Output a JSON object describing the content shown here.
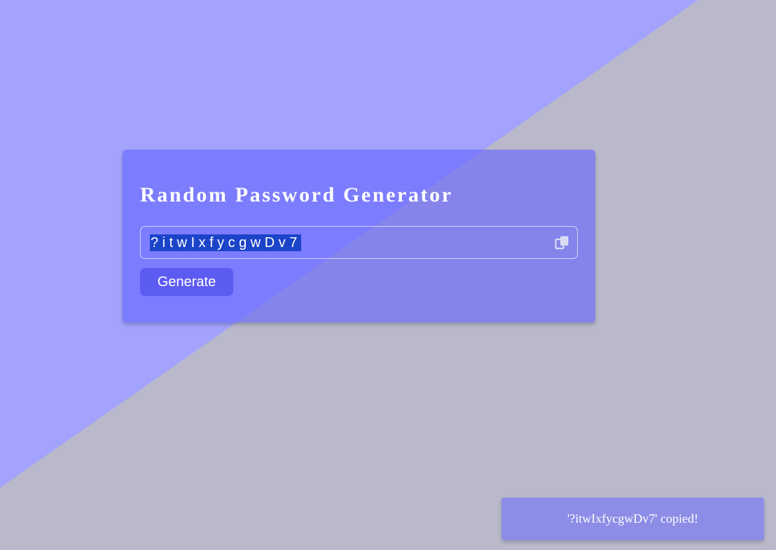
{
  "colors": {
    "background": "#b9b9cb",
    "background_accent": "#a3a3fd",
    "card": "#7a7af0",
    "button": "#5c5cf3",
    "selection": "#1c44c9",
    "toast": "#8b8de6",
    "text": "#ffffff"
  },
  "card": {
    "title": "Random Password Generator",
    "password": {
      "value": "?itwIxfycgwDv7",
      "selected": true,
      "copy_icon": "copy-icon"
    },
    "generate_label": "Generate"
  },
  "toast": {
    "message": "'?itwIxfycgwDv7' copied!"
  }
}
